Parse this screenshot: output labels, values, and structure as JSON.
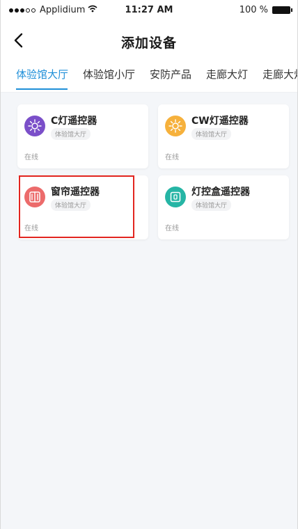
{
  "status_bar": {
    "carrier": "Applidium",
    "time": "11:27 AM",
    "battery": "100 %"
  },
  "nav": {
    "title": "添加设备"
  },
  "tabs": [
    {
      "label": "体验馆大厅",
      "active": true
    },
    {
      "label": "体验馆小厅",
      "active": false
    },
    {
      "label": "安防产品",
      "active": false
    },
    {
      "label": "走廊大灯",
      "active": false
    },
    {
      "label": "走廊大灯",
      "active": false
    }
  ],
  "devices": [
    {
      "name": "C灯遥控器",
      "room": "体验馆大厅",
      "status": "在线",
      "icon": "c-light-icon",
      "color": "#7b4fc9"
    },
    {
      "name": "CW灯遥控器",
      "room": "体验馆大厅",
      "status": "在线",
      "icon": "cw-light-icon",
      "color": "#f6b13c"
    },
    {
      "name": "窗帘遥控器",
      "room": "体验馆大厅",
      "status": "在线",
      "icon": "curtain-icon",
      "color": "#ec6b6b"
    },
    {
      "name": "灯控盒遥控器",
      "room": "体验馆大厅",
      "status": "在线",
      "icon": "light-box-icon",
      "color": "#26b5a5"
    }
  ],
  "colors": {
    "accent": "#1f8fd8",
    "highlight": "#e2251f"
  }
}
